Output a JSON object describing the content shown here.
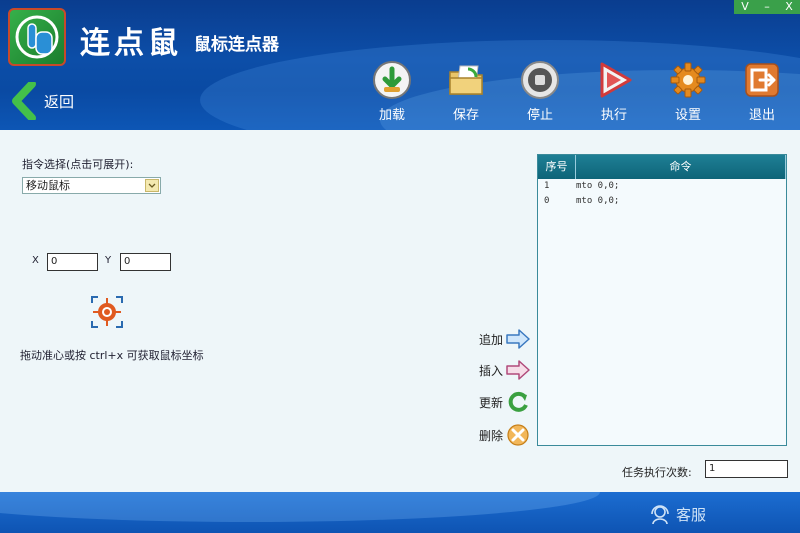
{
  "app": {
    "title": "连点鼠",
    "subtitle": "鼠标连点器"
  },
  "window_controls": {
    "menu": "V",
    "minimize": "–",
    "close": "X"
  },
  "back": {
    "label": "返回"
  },
  "toolbar": {
    "load": "加载",
    "save": "保存",
    "stop": "停止",
    "run": "执行",
    "settings": "设置",
    "exit": "退出"
  },
  "command_select": {
    "label": "指令选择(点击可展开):",
    "value": "移动鼠标"
  },
  "coords": {
    "x_label": "X",
    "x_value": "0",
    "y_label": "Y",
    "y_value": "0"
  },
  "hint": "拖动准心或按 ctrl+x 可获取鼠标坐标",
  "actions": {
    "add": "追加",
    "insert": "插入",
    "update": "更新",
    "delete": "删除"
  },
  "command_table": {
    "headers": [
      "序号",
      "命令"
    ],
    "rows": [
      {
        "index": "1",
        "command": "mto 0,0;"
      },
      {
        "index": "0",
        "command": "mto 0,0;"
      }
    ]
  },
  "repeat": {
    "label": "任务执行次数:",
    "value": "1"
  },
  "footer": {
    "service": "客服"
  }
}
